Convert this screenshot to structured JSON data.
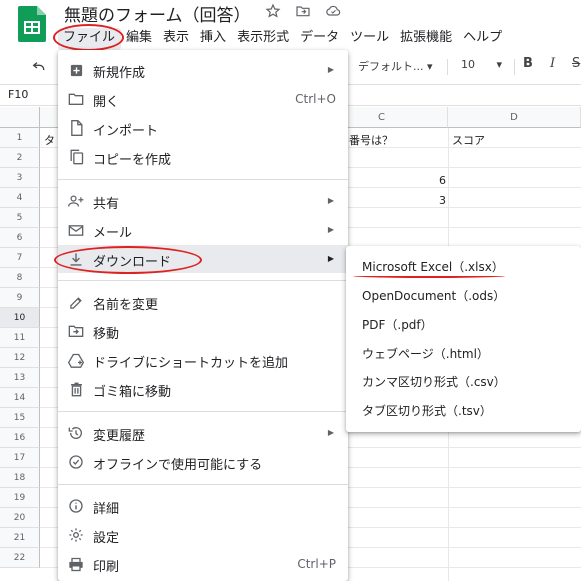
{
  "app": {
    "title": "無題のフォーム（回答）",
    "icons": [
      "star-icon",
      "move-to-folder-icon",
      "cloud-status-icon"
    ]
  },
  "menubar": [
    "ファイル",
    "編集",
    "表示",
    "挿入",
    "表示形式",
    "データ",
    "ツール",
    "拡張機能",
    "ヘルプ"
  ],
  "toolbar": {
    "font": "デフォルト...",
    "font_size": "10",
    "bold": "B",
    "italic": "I",
    "strike": "S"
  },
  "formula_bar": {
    "cell_ref": "F10"
  },
  "grid": {
    "col_c": "C",
    "col_d": "D",
    "row_numbers": [
      "1",
      "2",
      "3",
      "4",
      "5",
      "6",
      "7",
      "8",
      "9",
      "10",
      "11",
      "12",
      "13",
      "14",
      "15",
      "16",
      "17",
      "18",
      "19",
      "20",
      "21",
      "22"
    ],
    "a1_fragment": "タ",
    "c1_text": "番号は？",
    "d1_text": "スコア",
    "c3_value": "6",
    "c4_value": "3"
  },
  "file_menu": [
    {
      "label": "新規作成",
      "icon": "new-icon",
      "submenu": true
    },
    {
      "label": "開く",
      "icon": "folder-icon",
      "shortcut": "Ctrl+O"
    },
    {
      "label": "インポート",
      "icon": "import-file-icon"
    },
    {
      "label": "コピーを作成",
      "icon": "copy-icon"
    },
    {
      "label": "共有",
      "icon": "share-person-icon",
      "submenu": true
    },
    {
      "label": "メール",
      "icon": "mail-icon",
      "submenu": true
    },
    {
      "label": "ダウンロード",
      "icon": "download-icon",
      "submenu": true
    },
    {
      "label": "名前を変更",
      "icon": "rename-pencil-icon"
    },
    {
      "label": "移動",
      "icon": "move-folder-icon"
    },
    {
      "label": "ドライブにショートカットを追加",
      "icon": "drive-shortcut-icon"
    },
    {
      "label": "ゴミ箱に移動",
      "icon": "trash-icon"
    },
    {
      "label": "変更履歴",
      "icon": "history-icon",
      "submenu": true
    },
    {
      "label": "オフラインで使用可能にする",
      "icon": "offline-check-icon"
    },
    {
      "label": "詳細",
      "icon": "info-icon"
    },
    {
      "label": "設定",
      "icon": "settings-gear-icon"
    },
    {
      "label": "印刷",
      "icon": "print-icon",
      "shortcut": "Ctrl+P"
    }
  ],
  "download_submenu": [
    "Microsoft Excel（.xlsx）",
    "OpenDocument（.ods）",
    "PDF（.pdf）",
    "ウェブページ（.html）",
    "カンマ区切り形式（.csv）",
    "タブ区切り形式（.tsv）"
  ],
  "colors": {
    "annotation_red": "#d22",
    "sheets_green": "#0f9d58",
    "menu_highlight": "#e8eaed"
  }
}
